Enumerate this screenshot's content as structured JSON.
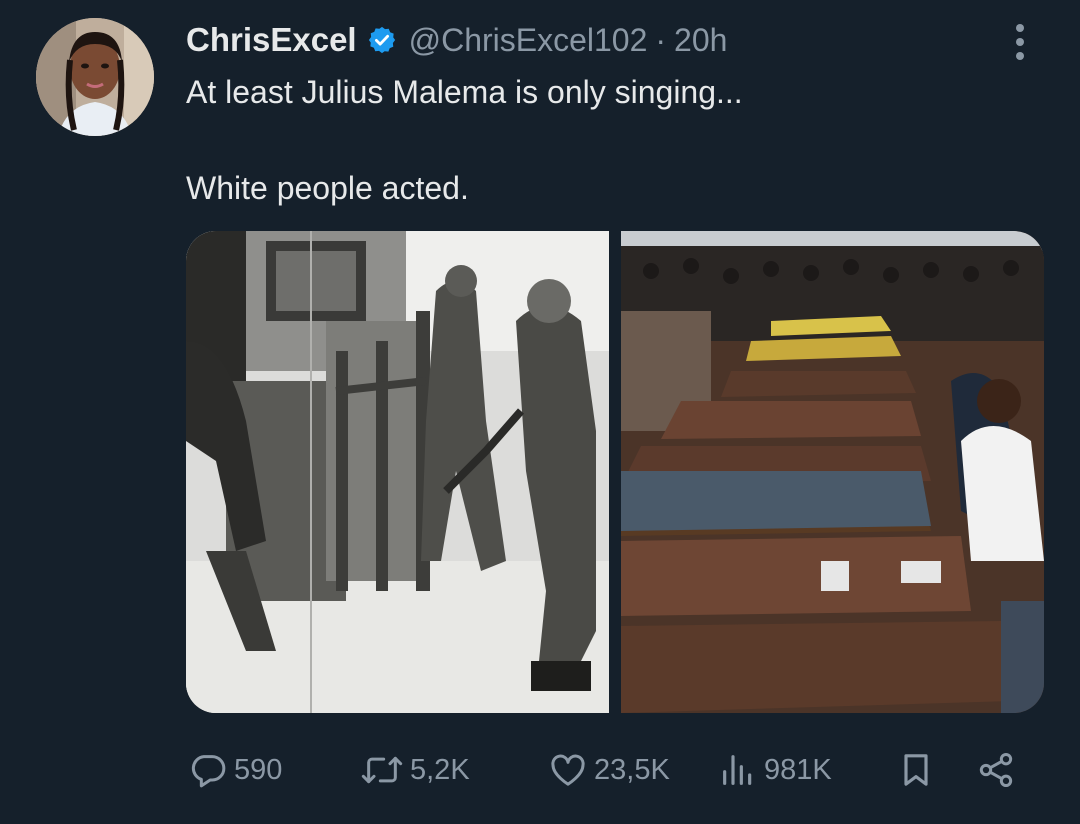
{
  "tweet": {
    "display_name": "ChrisExcel",
    "handle": "@ChrisExcel102",
    "separator": "·",
    "time": "20h",
    "text_lines": [
      "At least Julius Malema is only singing...",
      "White people acted."
    ]
  },
  "stats": {
    "replies": "590",
    "reposts": "5,2K",
    "likes": "23,5K",
    "views": "981K"
  },
  "colors": {
    "background": "#15202b",
    "text": "#e7e9ea",
    "muted": "#8b98a5",
    "verified": "#1d9bf0"
  },
  "icons": {
    "verified": "verified-badge-icon",
    "more": "more-dots-icon",
    "reply": "reply-bubble-icon",
    "repost": "repost-arrows-icon",
    "like": "heart-icon",
    "views": "views-bars-icon",
    "bookmark": "bookmark-icon",
    "share": "share-icon"
  }
}
